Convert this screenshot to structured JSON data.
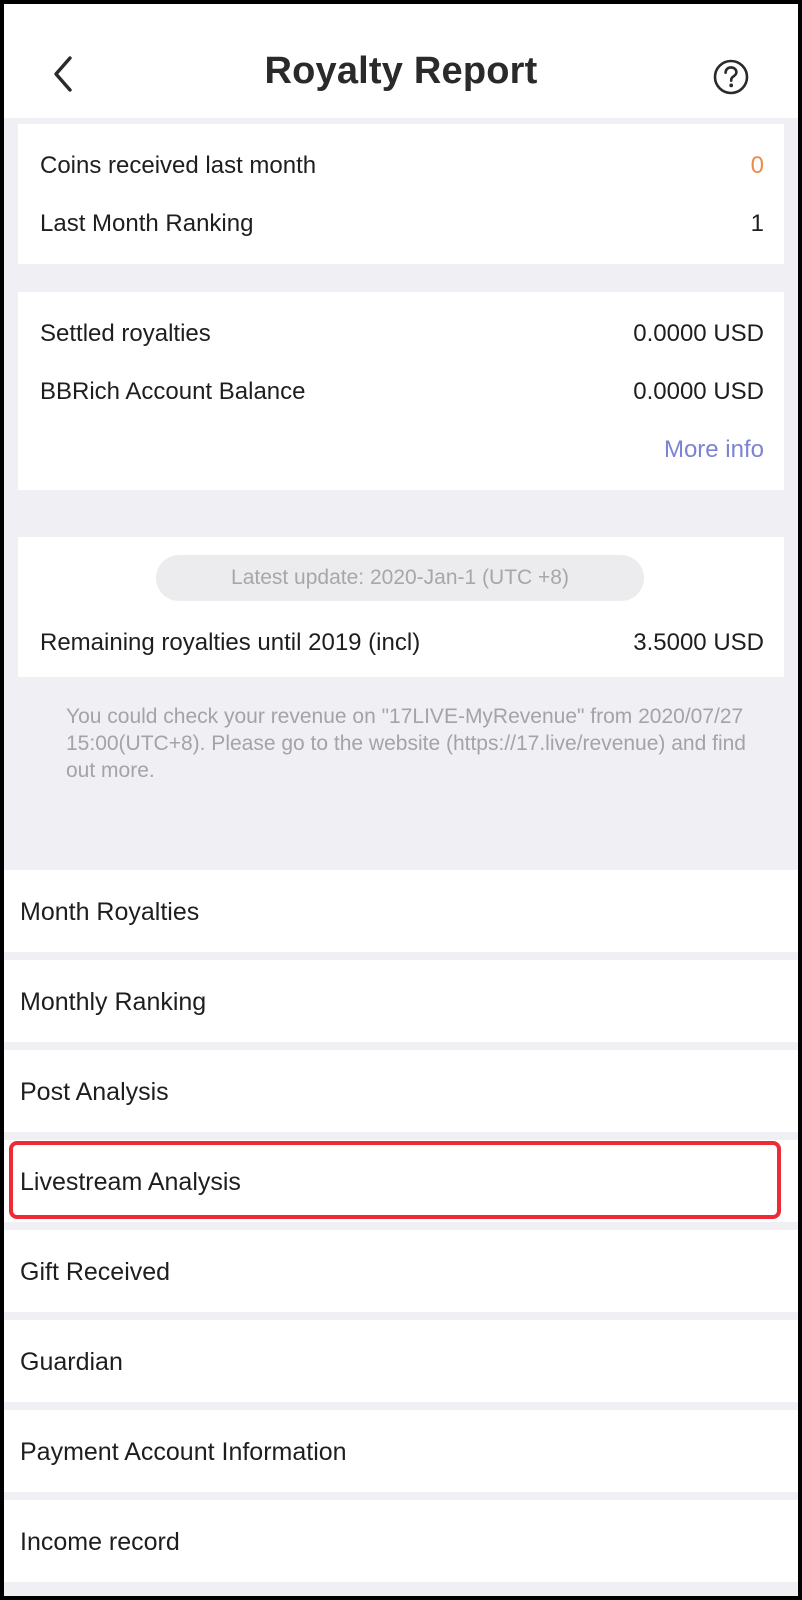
{
  "header": {
    "title": "Royalty Report",
    "back_icon": "chevron-left-icon",
    "help_icon": "question-circle-icon"
  },
  "summary": {
    "coins_label": "Coins received last month",
    "coins_value": "0",
    "ranking_label": "Last Month Ranking",
    "ranking_value": "1"
  },
  "royalties": {
    "settled_label": "Settled royalties",
    "settled_value": "0.0000 USD",
    "balance_label": "BBRich Account Balance",
    "balance_value": "0.0000 USD",
    "more_info": "More info"
  },
  "remaining": {
    "update_text": "Latest update: 2020-Jan-1 (UTC +8)",
    "label": "Remaining royalties until 2019 (incl)",
    "value": "3.5000 USD"
  },
  "notice": "You could check your revenue on \"17LIVE-MyRevenue\" from 2020/07/27 15:00(UTC+8). Please go to the website (https://17.live/revenue) and find out more.",
  "menu": [
    {
      "label": "Month Royalties"
    },
    {
      "label": "Monthly Ranking"
    },
    {
      "label": "Post Analysis"
    },
    {
      "label": "Livestream Analysis"
    },
    {
      "label": "Gift Received"
    },
    {
      "label": "Guardian"
    },
    {
      "label": "Payment Account Information"
    },
    {
      "label": "Income record"
    }
  ],
  "colors": {
    "accent_orange": "#f08a4b",
    "link_blue": "#7d83d3",
    "highlight_red": "#ee2b35",
    "background_gray": "#efeff4"
  }
}
